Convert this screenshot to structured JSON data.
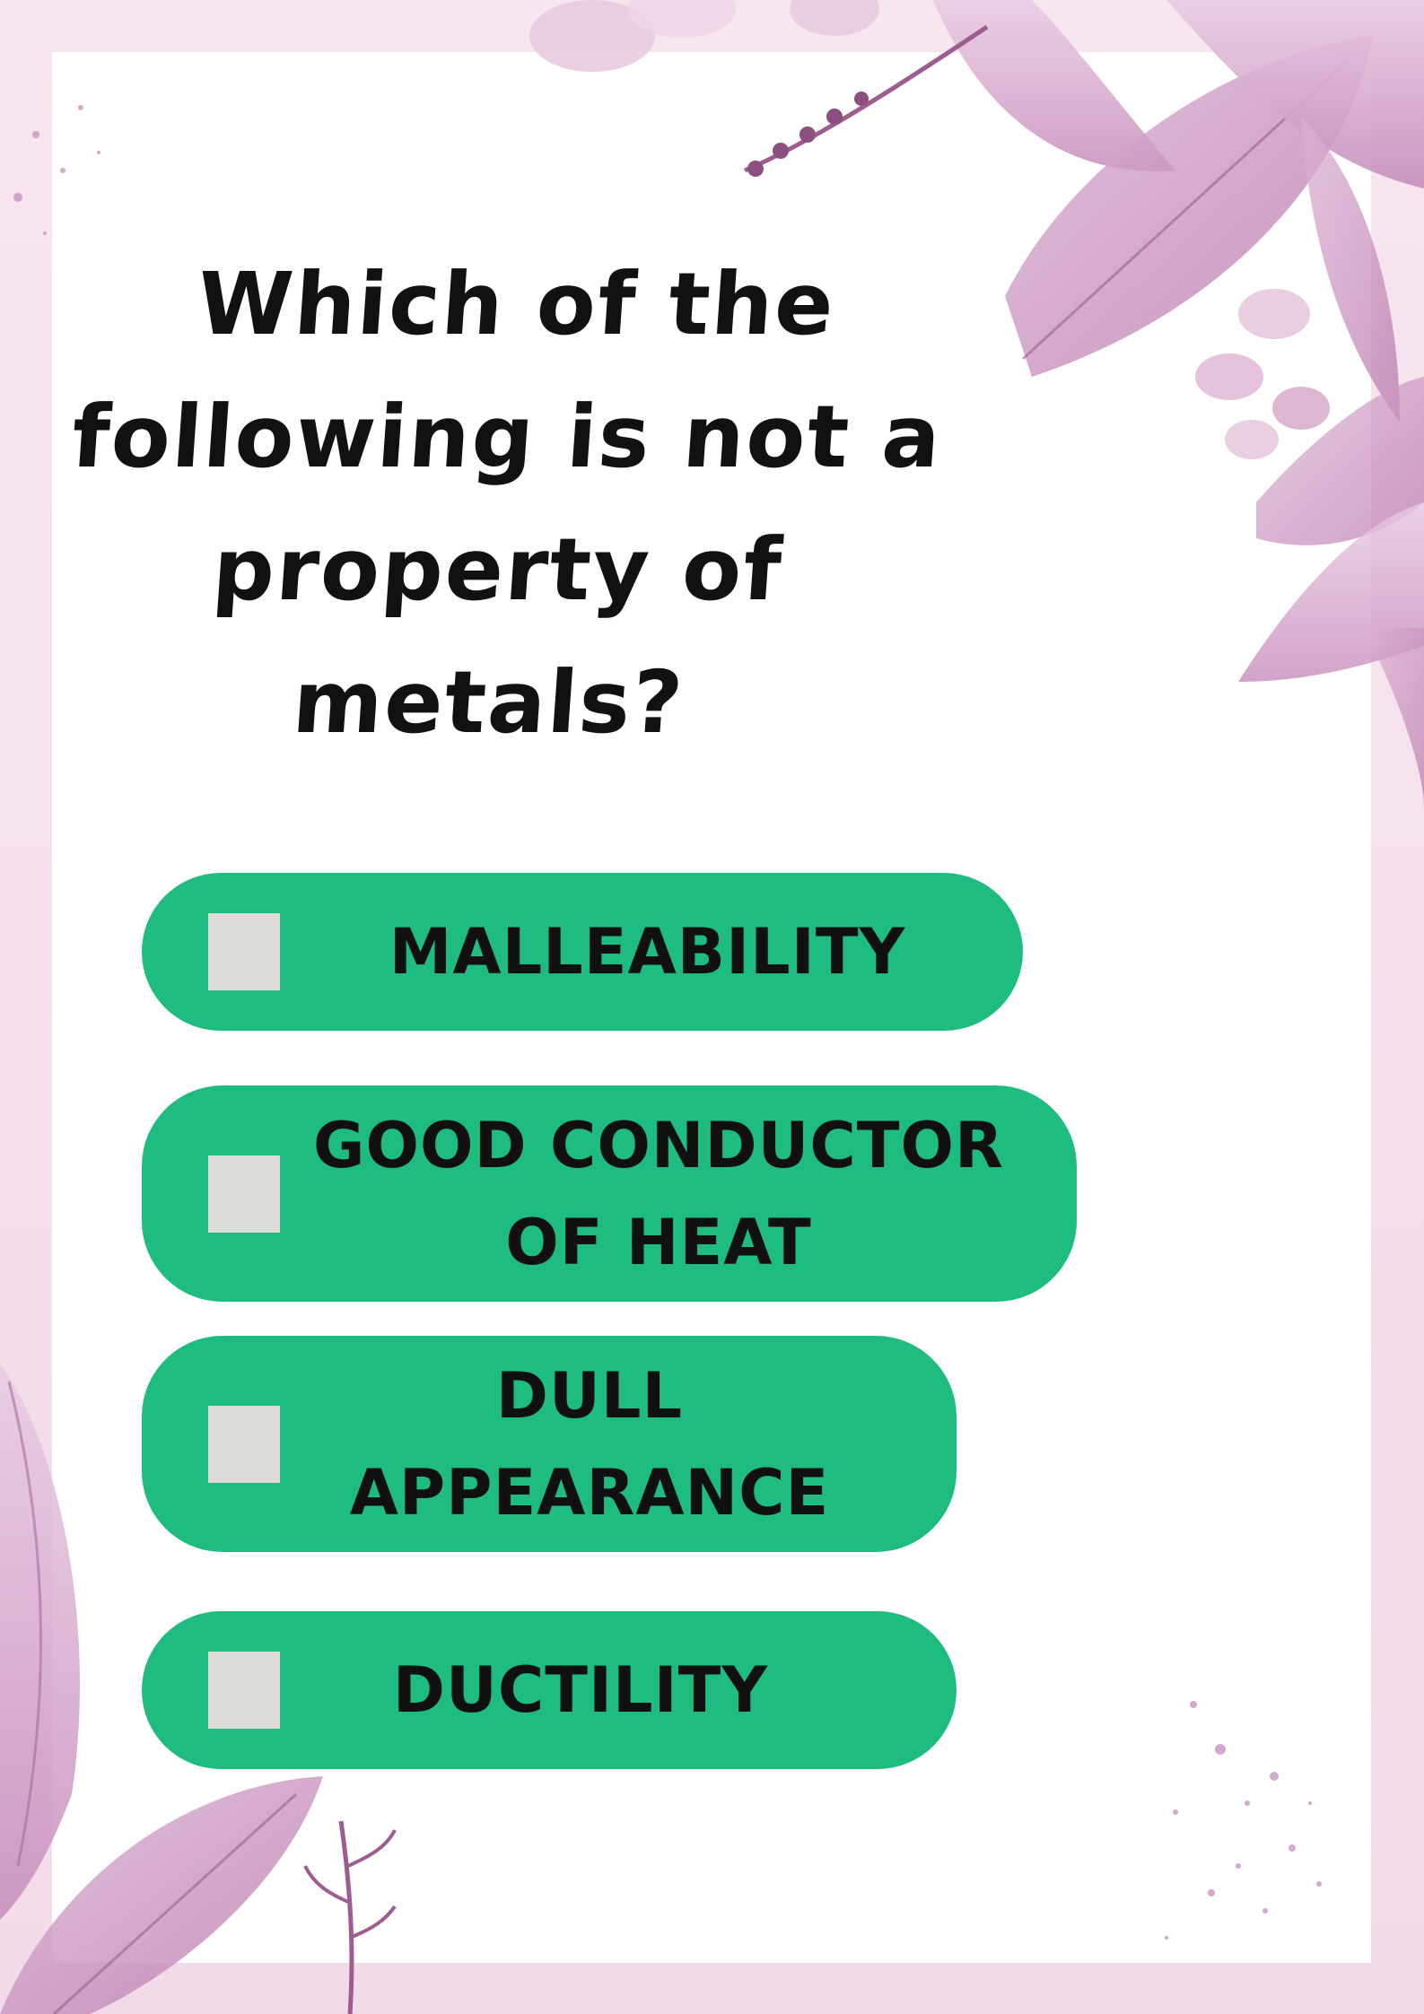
{
  "question": {
    "text": "Which of the\nfollowing is not a\nproperty of\nmetals?"
  },
  "options": [
    {
      "label": "MALLEABILITY",
      "checked": false
    },
    {
      "label": "GOOD CONDUCTOR\nOF HEAT",
      "checked": false
    },
    {
      "label": "DULL\nAPPEARANCE",
      "checked": false
    },
    {
      "label": "DUCTILITY",
      "checked": false
    }
  ],
  "colors": {
    "option_background": "#1fbc7f",
    "checkbox": "#dcdbd5",
    "border": "#f3dde9",
    "leaf": "#c98bbd",
    "text": "#111111"
  }
}
